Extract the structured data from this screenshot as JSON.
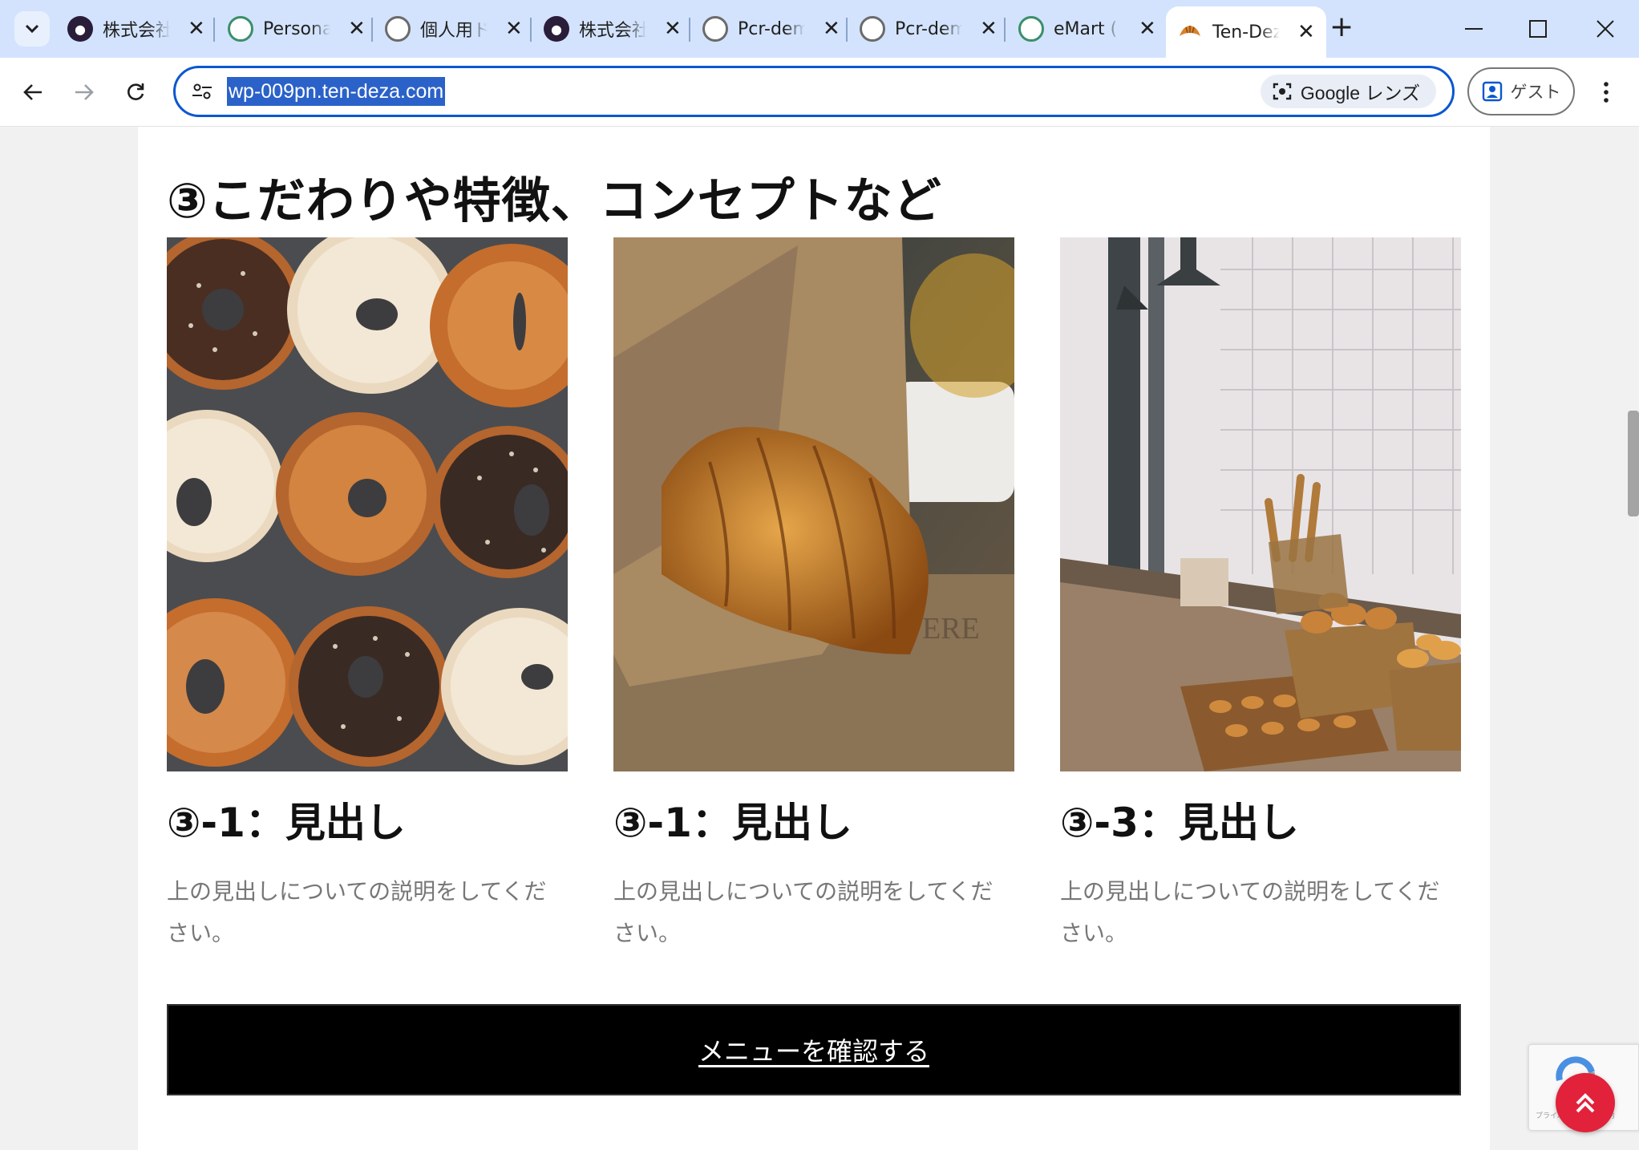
{
  "browser": {
    "tabs": [
      {
        "title": "株式会社",
        "favicon": "dark-logo"
      },
      {
        "title": "Personal",
        "favicon": "green-logo"
      },
      {
        "title": "個人用ドメ",
        "favicon": "gray-logo"
      },
      {
        "title": "株式会社",
        "favicon": "dark-logo"
      },
      {
        "title": "Pcr-demo",
        "favicon": "gray-logo"
      },
      {
        "title": "Pcr-demo",
        "favicon": "gray-logo"
      },
      {
        "title": "eMart (",
        "favicon": "green-logo"
      },
      {
        "title": "Ten-Deza",
        "favicon": "croissant-logo",
        "active": true
      }
    ],
    "url": "wp-009pn.ten-deza.com",
    "lens_label": "Google レンズ",
    "guest_label": "ゲスト"
  },
  "page": {
    "section_title": "③こだわりや特徴、コンセプトなど",
    "cards": [
      {
        "heading": "③-1：見出し",
        "description": "上の見出しについての説明をしてください。",
        "image": "bagels-photo"
      },
      {
        "heading": "③-1：見出し",
        "description": "上の見出しについての説明をしてください。",
        "image": "croissant-photo"
      },
      {
        "heading": "③-3：見出し",
        "description": "上の見出しについての説明をしてください。",
        "image": "bakery-counter-photo"
      }
    ],
    "cta_label": "メニューを確認する",
    "recaptcha_text": "プライバシー - 利用規約"
  },
  "colors": {
    "accent": "#0b57d0",
    "tabbar": "#d3e3fd",
    "cta_bg": "#000000",
    "totop_bg": "#e2213a"
  }
}
